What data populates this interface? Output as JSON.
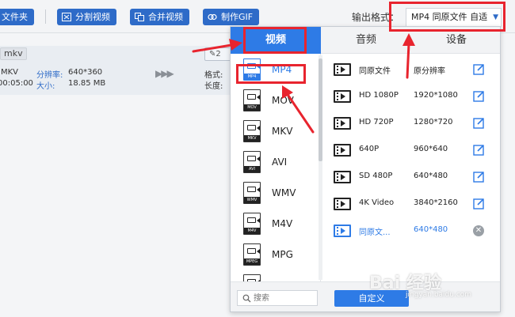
{
  "toolbar": {
    "add_folder": "文件夹",
    "split_video": "分割视频",
    "merge_video": "合并视频",
    "make_gif": "制作GIF",
    "output_format_label": "输出格式：",
    "output_format_value": "MP4  同原文件 自适"
  },
  "file": {
    "ext": "mkv",
    "format": "MKV",
    "duration": "00:05:00",
    "resolution_label": "分辨率:",
    "resolution": "640*360",
    "size_label": "大小:",
    "size": "18.85 MB",
    "edit_label": "2",
    "format_label": "格式:",
    "length_label": "长度:"
  },
  "panel": {
    "tabs": [
      {
        "label": "视频"
      },
      {
        "label": "音频"
      },
      {
        "label": "设备"
      }
    ],
    "formats": [
      {
        "name": "MP4",
        "tag": "MP4"
      },
      {
        "name": "MOV",
        "tag": "MOV"
      },
      {
        "name": "MKV",
        "tag": "MKV"
      },
      {
        "name": "AVI",
        "tag": "AVI"
      },
      {
        "name": "WMV",
        "tag": "WMV"
      },
      {
        "name": "M4V",
        "tag": "M4V"
      },
      {
        "name": "MPG",
        "tag": "MPEG"
      }
    ],
    "qualities": [
      {
        "name": "同原文件",
        "res": "原分辨率"
      },
      {
        "name": "HD 1080P",
        "res": "1920*1080"
      },
      {
        "name": "HD 720P",
        "res": "1280*720"
      },
      {
        "name": "640P",
        "res": "960*640"
      },
      {
        "name": "SD 480P",
        "res": "640*480"
      },
      {
        "name": "4K Video",
        "res": "3840*2160"
      },
      {
        "name": "同原文...",
        "res": "640*480"
      }
    ],
    "search_placeholder": "搜索",
    "custom_label": "自定义"
  },
  "watermark": {
    "text": "Bai 经验",
    "sub": "jingyan.baidu.com"
  },
  "colors": {
    "accent": "#2e7be6",
    "toolbar_button": "#2e6bc8",
    "highlight": "#e8242e"
  }
}
